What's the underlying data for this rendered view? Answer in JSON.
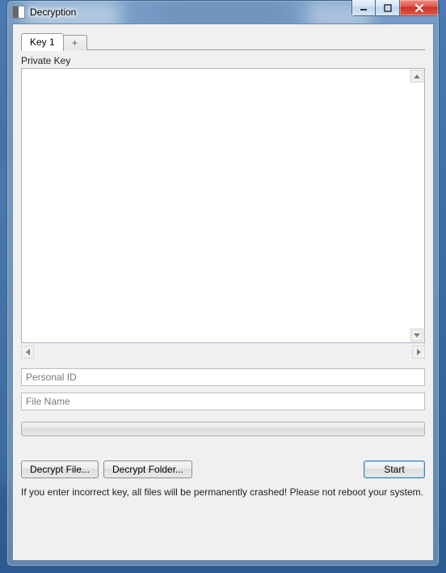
{
  "window": {
    "title": "Decryption"
  },
  "tabs": {
    "items": [
      {
        "label": "Key 1",
        "active": true
      }
    ],
    "add_label": "+"
  },
  "form": {
    "private_key_label": "Private Key",
    "private_key_value": "",
    "personal_id_placeholder": "Personal ID",
    "personal_id_value": "",
    "file_name_placeholder": "File Name",
    "file_name_value": ""
  },
  "progress": {
    "percent": 0
  },
  "buttons": {
    "decrypt_file": "Decrypt File...",
    "decrypt_folder": "Decrypt Folder...",
    "start": "Start"
  },
  "warning_text": "If you enter incorrect key, all files will be permanently crashed! Please not reboot your system."
}
